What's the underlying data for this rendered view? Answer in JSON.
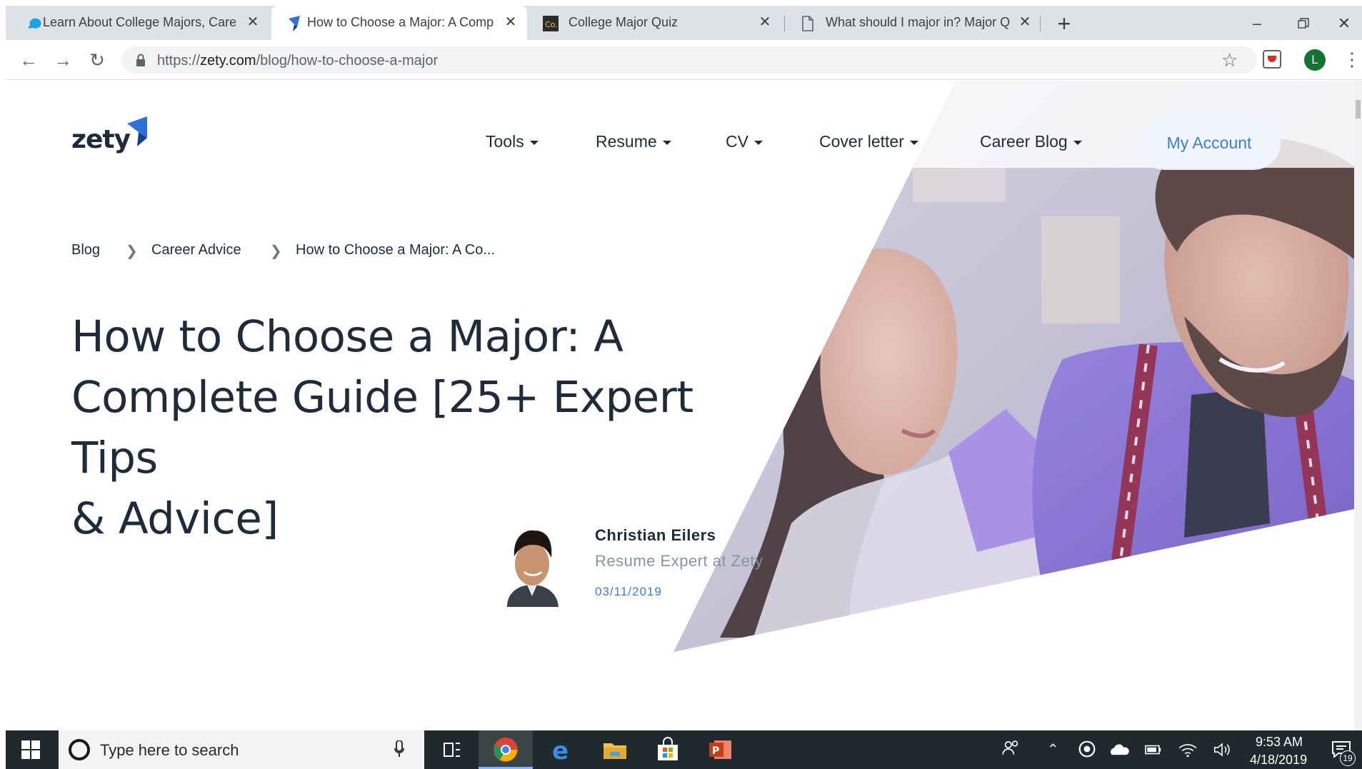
{
  "browser": {
    "tabs": [
      {
        "title": "Learn About College Majors, Care",
        "favicon": "speech-bubble-icon",
        "active": false
      },
      {
        "title": "How to Choose a Major: A Comp",
        "favicon": "zety-icon",
        "active": true
      },
      {
        "title": "College Major Quiz",
        "favicon": "co-icon",
        "active": false
      },
      {
        "title": "What should I major in? Major Q",
        "favicon": "document-icon",
        "active": false
      }
    ],
    "new_tab": "+",
    "url_prefix": "https://",
    "url_host": "zety.com",
    "url_path": "/blog/how-to-choose-a-major",
    "profile_initial": "L"
  },
  "site": {
    "logo": "zety",
    "nav": [
      {
        "label": "Tools"
      },
      {
        "label": "Resume"
      },
      {
        "label": "CV"
      },
      {
        "label": "Cover letter"
      },
      {
        "label": "Career Blog"
      }
    ],
    "account_button": "My Account"
  },
  "breadcrumb": [
    "Blog",
    "Career Advice",
    "How to Choose a Major: A Co..."
  ],
  "article": {
    "title_lines": [
      "How to Choose a Major: A",
      "Complete Guide [25+ Expert Tips",
      "& Advice]"
    ],
    "author_name": "Christian Eilers",
    "author_role": "Resume Expert at Zety",
    "date": "03/11/2019"
  },
  "taskbar": {
    "search_placeholder": "Type here to search",
    "time": "9:53 AM",
    "date": "4/18/2019",
    "notification_count": "19"
  },
  "colors": {
    "accent": "#3b7ddd",
    "heading": "#1f2b3a",
    "photo_purple": "#7b5fc4"
  }
}
